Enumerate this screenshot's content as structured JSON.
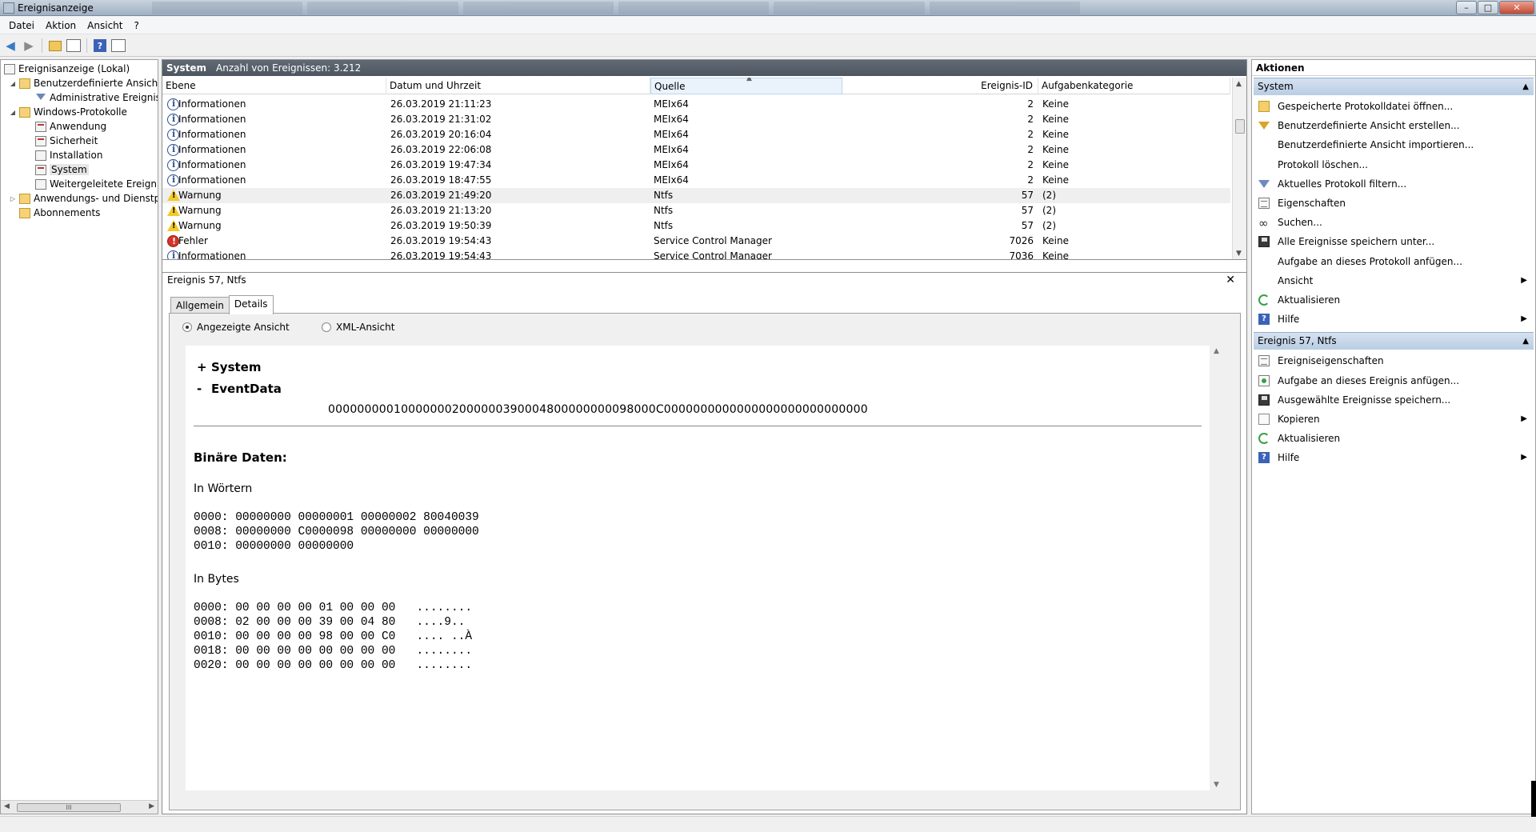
{
  "window": {
    "title": "Ereignisanzeige",
    "buttons": [
      "–",
      "□",
      "✕"
    ]
  },
  "menu": [
    "Datei",
    "Aktion",
    "Ansicht",
    "?"
  ],
  "toolbar": [
    "back-icon",
    "forward-icon",
    "up-folder-icon",
    "show-hide-tree-icon",
    "help-icon",
    "show-hide-actions-icon"
  ],
  "tree": {
    "nodes": [
      {
        "label": "Ereignisanzeige (Lokal)",
        "icon": "event-viewer-icon"
      },
      {
        "label": "Benutzerdefinierte Ansichten",
        "icon": "folder-icon",
        "expander": "◢"
      },
      {
        "label": "Administrative Ereignisse",
        "icon": "filter-icon"
      },
      {
        "label": "Windows-Protokolle",
        "icon": "folder-icon",
        "expander": "◢"
      },
      {
        "label": "Anwendung",
        "icon": "log-icon"
      },
      {
        "label": "Sicherheit",
        "icon": "log-icon"
      },
      {
        "label": "Installation",
        "icon": "log-icon"
      },
      {
        "label": "System",
        "icon": "log-icon",
        "selected": true
      },
      {
        "label": "Weitergeleitete Ereignisse",
        "icon": "log-icon"
      },
      {
        "label": "Anwendungs- und Dienstprotokolle",
        "icon": "folder-icon",
        "expander": "▷"
      },
      {
        "label": "Abonnements",
        "icon": "folder-icon"
      }
    ],
    "hscroll_thumb": "III"
  },
  "log_header": {
    "name": "System",
    "count": "Anzahl von Ereignissen: 3.212"
  },
  "grid": {
    "columns": [
      "Ebene",
      "Datum und Uhrzeit",
      "Quelle",
      "Ereignis-ID",
      "Aufgabenkategorie"
    ],
    "sorted_column": "Quelle",
    "rows": [
      {
        "level": "Informationen",
        "icon": "info",
        "date": "26.03.2019 21:11:23",
        "source": "MEIx64",
        "id": "2",
        "category": "Keine"
      },
      {
        "level": "Informationen",
        "icon": "info",
        "date": "26.03.2019 21:31:02",
        "source": "MEIx64",
        "id": "2",
        "category": "Keine"
      },
      {
        "level": "Informationen",
        "icon": "info",
        "date": "26.03.2019 20:16:04",
        "source": "MEIx64",
        "id": "2",
        "category": "Keine"
      },
      {
        "level": "Informationen",
        "icon": "info",
        "date": "26.03.2019 22:06:08",
        "source": "MEIx64",
        "id": "2",
        "category": "Keine"
      },
      {
        "level": "Informationen",
        "icon": "info",
        "date": "26.03.2019 19:47:34",
        "source": "MEIx64",
        "id": "2",
        "category": "Keine"
      },
      {
        "level": "Informationen",
        "icon": "info",
        "date": "26.03.2019 18:47:55",
        "source": "MEIx64",
        "id": "2",
        "category": "Keine"
      },
      {
        "level": "Warnung",
        "icon": "warn",
        "date": "26.03.2019 21:49:20",
        "source": "Ntfs",
        "id": "57",
        "category": "(2)",
        "highlight": true
      },
      {
        "level": "Warnung",
        "icon": "warn",
        "date": "26.03.2019 21:13:20",
        "source": "Ntfs",
        "id": "57",
        "category": "(2)"
      },
      {
        "level": "Warnung",
        "icon": "warn",
        "date": "26.03.2019 19:50:39",
        "source": "Ntfs",
        "id": "57",
        "category": "(2)"
      },
      {
        "level": "Fehler",
        "icon": "error",
        "date": "26.03.2019 19:54:43",
        "source": "Service Control Manager",
        "id": "7026",
        "category": "Keine"
      },
      {
        "level": "Informationen",
        "icon": "info",
        "date": "26.03.2019 19:54:43",
        "source": "Service Control Manager",
        "id": "7036",
        "category": "Keine"
      }
    ]
  },
  "detail": {
    "title": "Ereignis 57, Ntfs",
    "close": "✕",
    "tabs": [
      "Allgemein",
      "Details"
    ],
    "active_tab": "Details",
    "view_options": [
      "Angezeigte Ansicht",
      "XML-Ansicht"
    ],
    "selected_view": "Angezeigte Ansicht",
    "system_label": "System",
    "system_sign": "+",
    "eventdata_label": "EventData",
    "eventdata_sign": "-",
    "eventdata_value": "000000000100000002000000390004800000000098000C0000000000000000000000000000",
    "binary_title": "Binäre Daten:",
    "words_title": "In Wörtern",
    "words_lines": [
      "0000: 00000000 00000001 00000002 80040039",
      "0008: 00000000 C0000098 00000000 00000000",
      "0010: 00000000 00000000"
    ],
    "bytes_title": "In Bytes",
    "bytes_lines": [
      "0000: 00 00 00 00 01 00 00 00   ........",
      "0008: 02 00 00 00 39 00 04 80   ....9..",
      "0010: 00 00 00 00 98 00 00 C0   .... ..À",
      "0018: 00 00 00 00 00 00 00 00   ........",
      "0020: 00 00 00 00 00 00 00 00   ........"
    ]
  },
  "actions": {
    "title": "Aktionen",
    "groups": [
      {
        "label": "System",
        "items": [
          {
            "label": "Gespeicherte Protokolldatei öffnen...",
            "icon": "folder-open-icon"
          },
          {
            "label": "Benutzerdefinierte Ansicht erstellen...",
            "icon": "filter-create-icon"
          },
          {
            "label": "Benutzerdefinierte Ansicht importieren...",
            "icon": ""
          },
          {
            "label": "Protokoll löschen...",
            "icon": ""
          },
          {
            "label": "Aktuelles Protokoll filtern...",
            "icon": "filter-icon"
          },
          {
            "label": "Eigenschaften",
            "icon": "properties-icon"
          },
          {
            "label": "Suchen...",
            "icon": "binoculars-icon"
          },
          {
            "label": "Alle Ereignisse speichern unter...",
            "icon": "save-icon"
          },
          {
            "label": "Aufgabe an dieses Protokoll anfügen...",
            "icon": ""
          },
          {
            "label": "Ansicht",
            "icon": "",
            "submenu": true
          },
          {
            "label": "Aktualisieren",
            "icon": "refresh-icon"
          },
          {
            "label": "Hilfe",
            "icon": "help-icon",
            "submenu": true
          }
        ]
      },
      {
        "label": "Ereignis 57, Ntfs",
        "items": [
          {
            "label": "Ereigniseigenschaften",
            "icon": "properties-icon"
          },
          {
            "label": "Aufgabe an dieses Ereignis anfügen...",
            "icon": "task-icon"
          },
          {
            "label": "Ausgewählte Ereignisse speichern...",
            "icon": "save-icon"
          },
          {
            "label": "Kopieren",
            "icon": "copy-icon",
            "submenu": true
          },
          {
            "label": "Aktualisieren",
            "icon": "refresh-icon"
          },
          {
            "label": "Hilfe",
            "icon": "help-icon",
            "submenu": true
          }
        ]
      }
    ]
  },
  "colors": {
    "group_header": "#c8d8ea",
    "center_header": "#56606b",
    "warning": "#f3c928",
    "error": "#d4342a",
    "info": "#2d4f8e"
  }
}
